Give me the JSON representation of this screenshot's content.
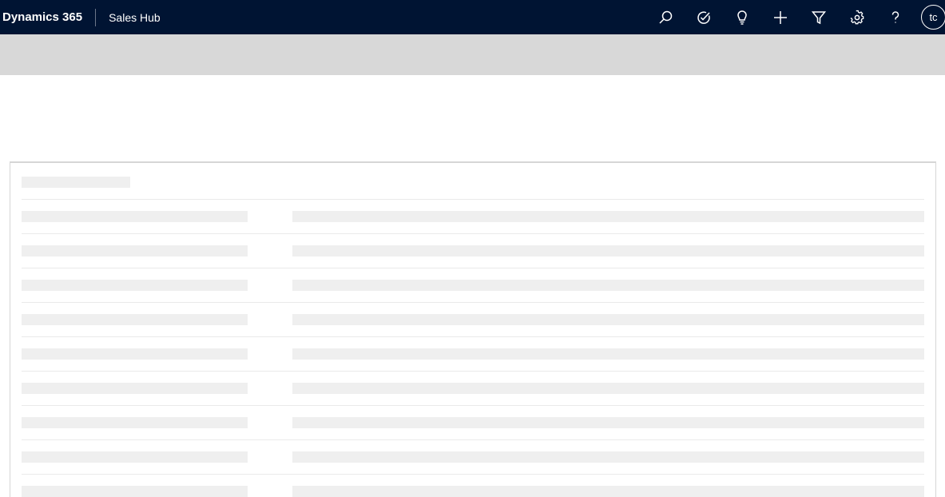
{
  "header": {
    "brand": "Dynamics 365",
    "app_name": "Sales Hub",
    "icons": [
      "search-icon",
      "task-check-icon",
      "lightbulb-icon",
      "plus-icon",
      "filter-icon",
      "gear-icon",
      "help-icon"
    ],
    "user_initials": "tc",
    "background_color": "#001433"
  },
  "loading": {
    "skeleton_rows": 9,
    "skeleton_color": "#efefef"
  }
}
